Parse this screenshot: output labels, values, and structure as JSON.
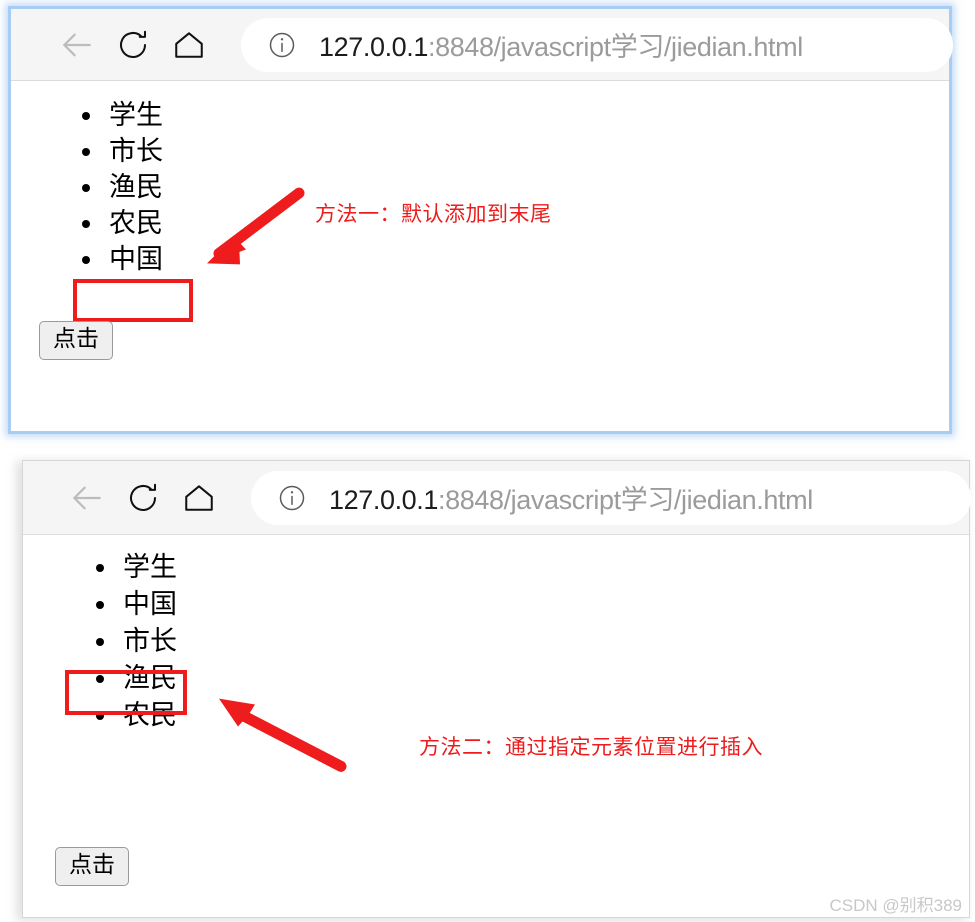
{
  "panels": [
    {
      "name": "method-one",
      "browser": {
        "back_icon": "arrow-left-icon",
        "reload_icon": "reload-icon",
        "home_icon": "home-icon",
        "info_icon": "info-circle-icon",
        "url_host": "127.0.0.1",
        "url_rest": ":8848/javascript学习/jiedian.html",
        "url_full": "127.0.0.1:8848/javascript学习/jiedian.html"
      },
      "list_items": [
        "学生",
        "市长",
        "渔民",
        "农民",
        "中国"
      ],
      "highlighted_index": 4,
      "button_label": "点击",
      "annotation": "方法一：默认添加到末尾",
      "annotation_color": "#ee1c1c"
    },
    {
      "name": "method-two",
      "browser": {
        "back_icon": "arrow-left-icon",
        "reload_icon": "reload-icon",
        "home_icon": "home-icon",
        "info_icon": "info-circle-icon",
        "url_host": "127.0.0.1",
        "url_rest": ":8848/javascript学习/jiedian.html",
        "url_full": "127.0.0.1:8848/javascript学习/jiedian.html"
      },
      "list_items": [
        "学生",
        "中国",
        "市长",
        "渔民",
        "农民"
      ],
      "highlighted_index": 1,
      "button_label": "点击",
      "annotation": "方法二：通过指定元素位置进行插入",
      "annotation_color": "#ee1c1c"
    }
  ],
  "watermark": "CSDN @别积389"
}
